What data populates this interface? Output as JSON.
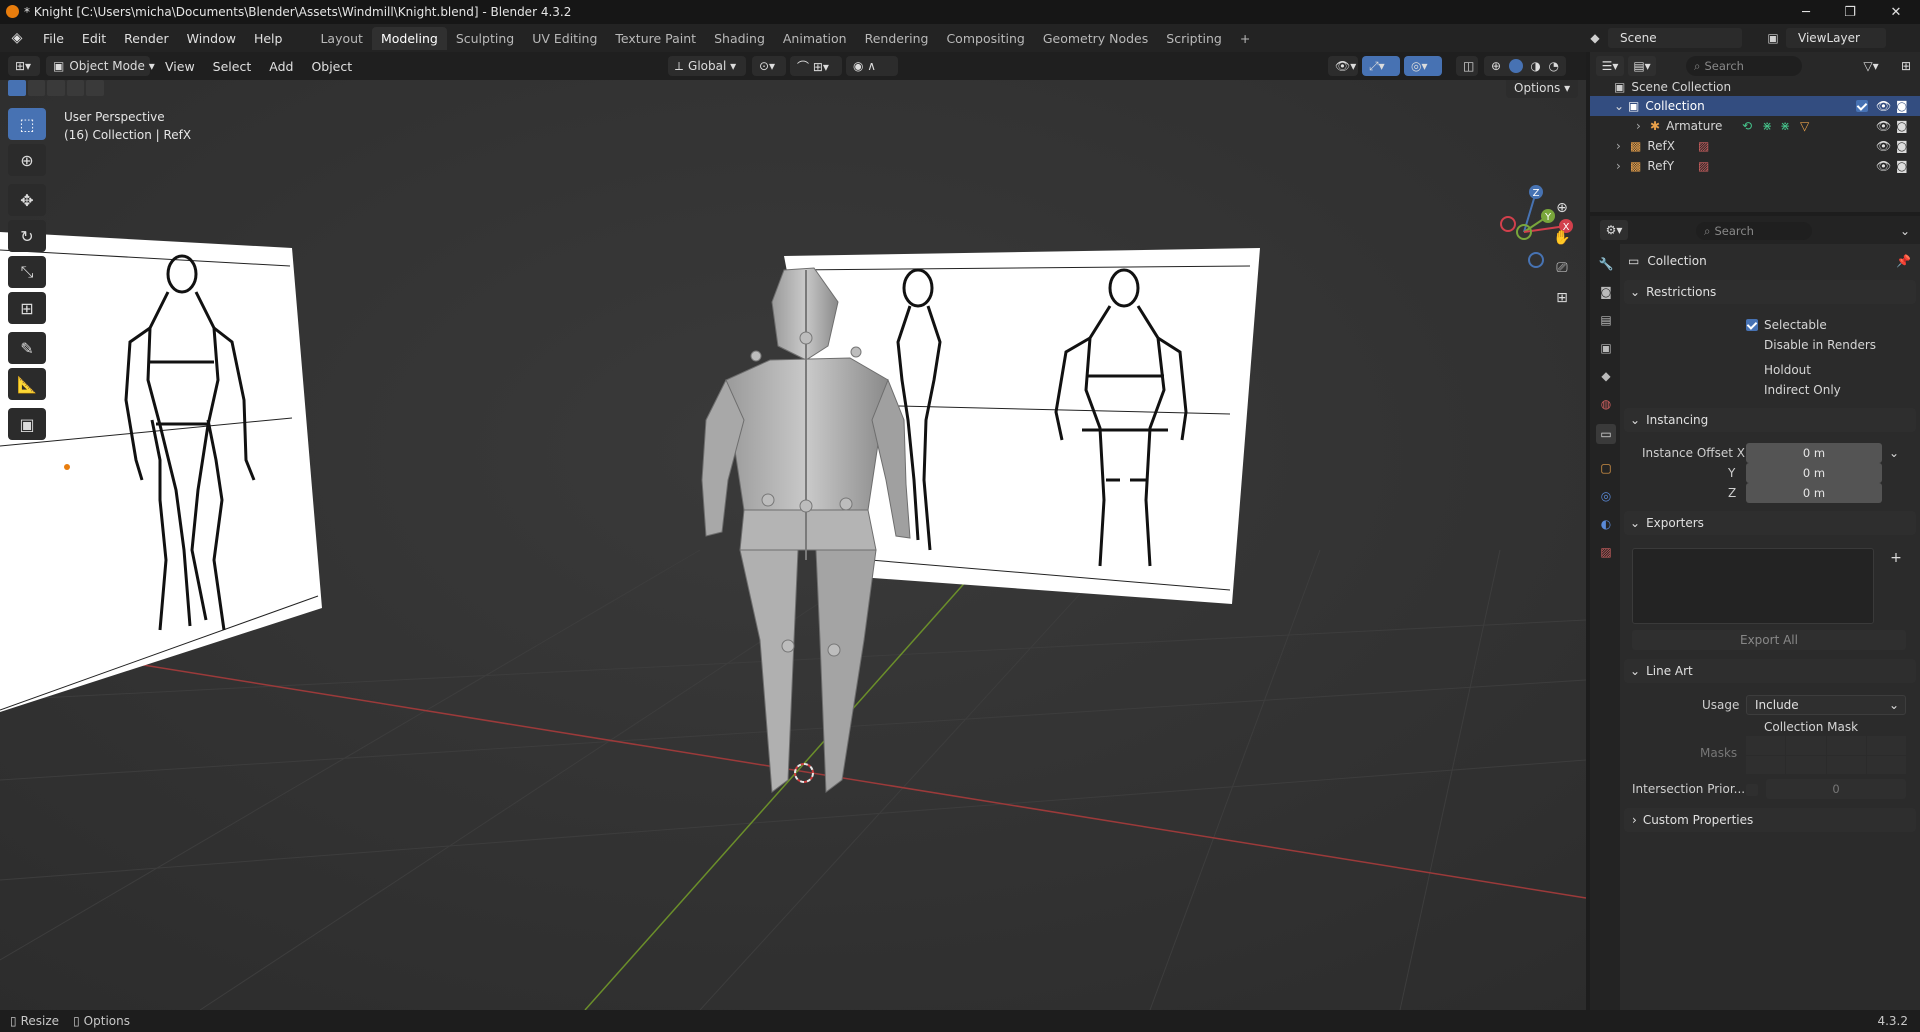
{
  "window": {
    "title": "* Knight [C:\\Users\\micha\\Documents\\Blender\\Assets\\Windmill\\Knight.blend] - Blender 4.3.2",
    "minimize": "─",
    "maximize": "❐",
    "close": "✕"
  },
  "menubar": {
    "items": [
      "File",
      "Edit",
      "Render",
      "Window",
      "Help"
    ]
  },
  "workspaces": {
    "tabs": [
      "Layout",
      "Modeling",
      "Sculpting",
      "UV Editing",
      "Texture Paint",
      "Shading",
      "Animation",
      "Rendering",
      "Compositing",
      "Geometry Nodes",
      "Scripting"
    ],
    "active": "Modeling",
    "add": "+"
  },
  "scene": {
    "name": "Scene",
    "view_layer": "ViewLayer"
  },
  "viewport_header": {
    "mode": "Object Mode",
    "menus": [
      "View",
      "Select",
      "Add",
      "Object"
    ],
    "transform_orientation": "Global",
    "options": "Options"
  },
  "viewport": {
    "perspective": "User Perspective",
    "collection_info": "(16) Collection | RefX",
    "gizmo": {
      "x": "X",
      "y": "Y",
      "z": "Z"
    }
  },
  "outliner": {
    "search_placeholder": "Search",
    "scene_collection": "Scene Collection",
    "items": [
      {
        "label": "Collection",
        "selected": true
      },
      {
        "label": "Armature"
      },
      {
        "label": "RefX"
      },
      {
        "label": "RefY"
      }
    ]
  },
  "properties": {
    "search_placeholder": "Search",
    "context": "Collection",
    "restrictions": {
      "title": "Restrictions",
      "selectable": "Selectable",
      "disable_in_renders": "Disable in Renders",
      "holdout": "Holdout",
      "indirect_only": "Indirect Only"
    },
    "instancing": {
      "title": "Instancing",
      "offset_x_label": "Instance Offset X",
      "y_label": "Y",
      "z_label": "Z",
      "x": "0 m",
      "y": "0 m",
      "z": "0 m"
    },
    "exporters": {
      "title": "Exporters",
      "export_all": "Export All"
    },
    "line_art": {
      "title": "Line Art",
      "usage_label": "Usage",
      "usage_value": "Include",
      "collection_mask": "Collection Mask",
      "masks_label": "Masks",
      "intersection_label": "Intersection Prior...",
      "intersection_value": "0"
    },
    "custom_properties": {
      "title": "Custom Properties"
    }
  },
  "statusbar": {
    "resize": "Resize",
    "options": "Options",
    "version": "4.3.2"
  }
}
